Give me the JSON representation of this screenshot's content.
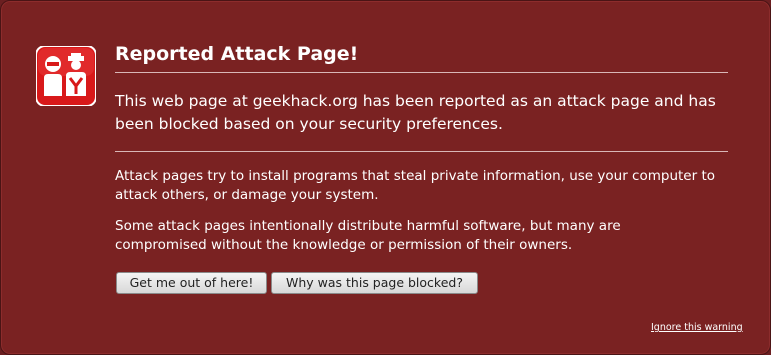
{
  "colors": {
    "background": "#7a2222",
    "text": "#ffffff",
    "icon_red": "#d8191a"
  },
  "icon": "attack-page-shield-icon",
  "title": "Reported Attack Page!",
  "short_description": "This web page at geekhack.org has been reported as an attack page and has been blocked based on your security preferences.",
  "paragraphs": [
    "Attack pages try to install programs that steal private information, use your computer to attack others, or damage your system.",
    "Some attack pages intentionally distribute harmful software, but many are compromised without the knowledge or permission of their owners."
  ],
  "buttons": {
    "get_out": "Get me out of here!",
    "why_blocked": "Why was this page blocked?"
  },
  "ignore_link": "Ignore this warning"
}
